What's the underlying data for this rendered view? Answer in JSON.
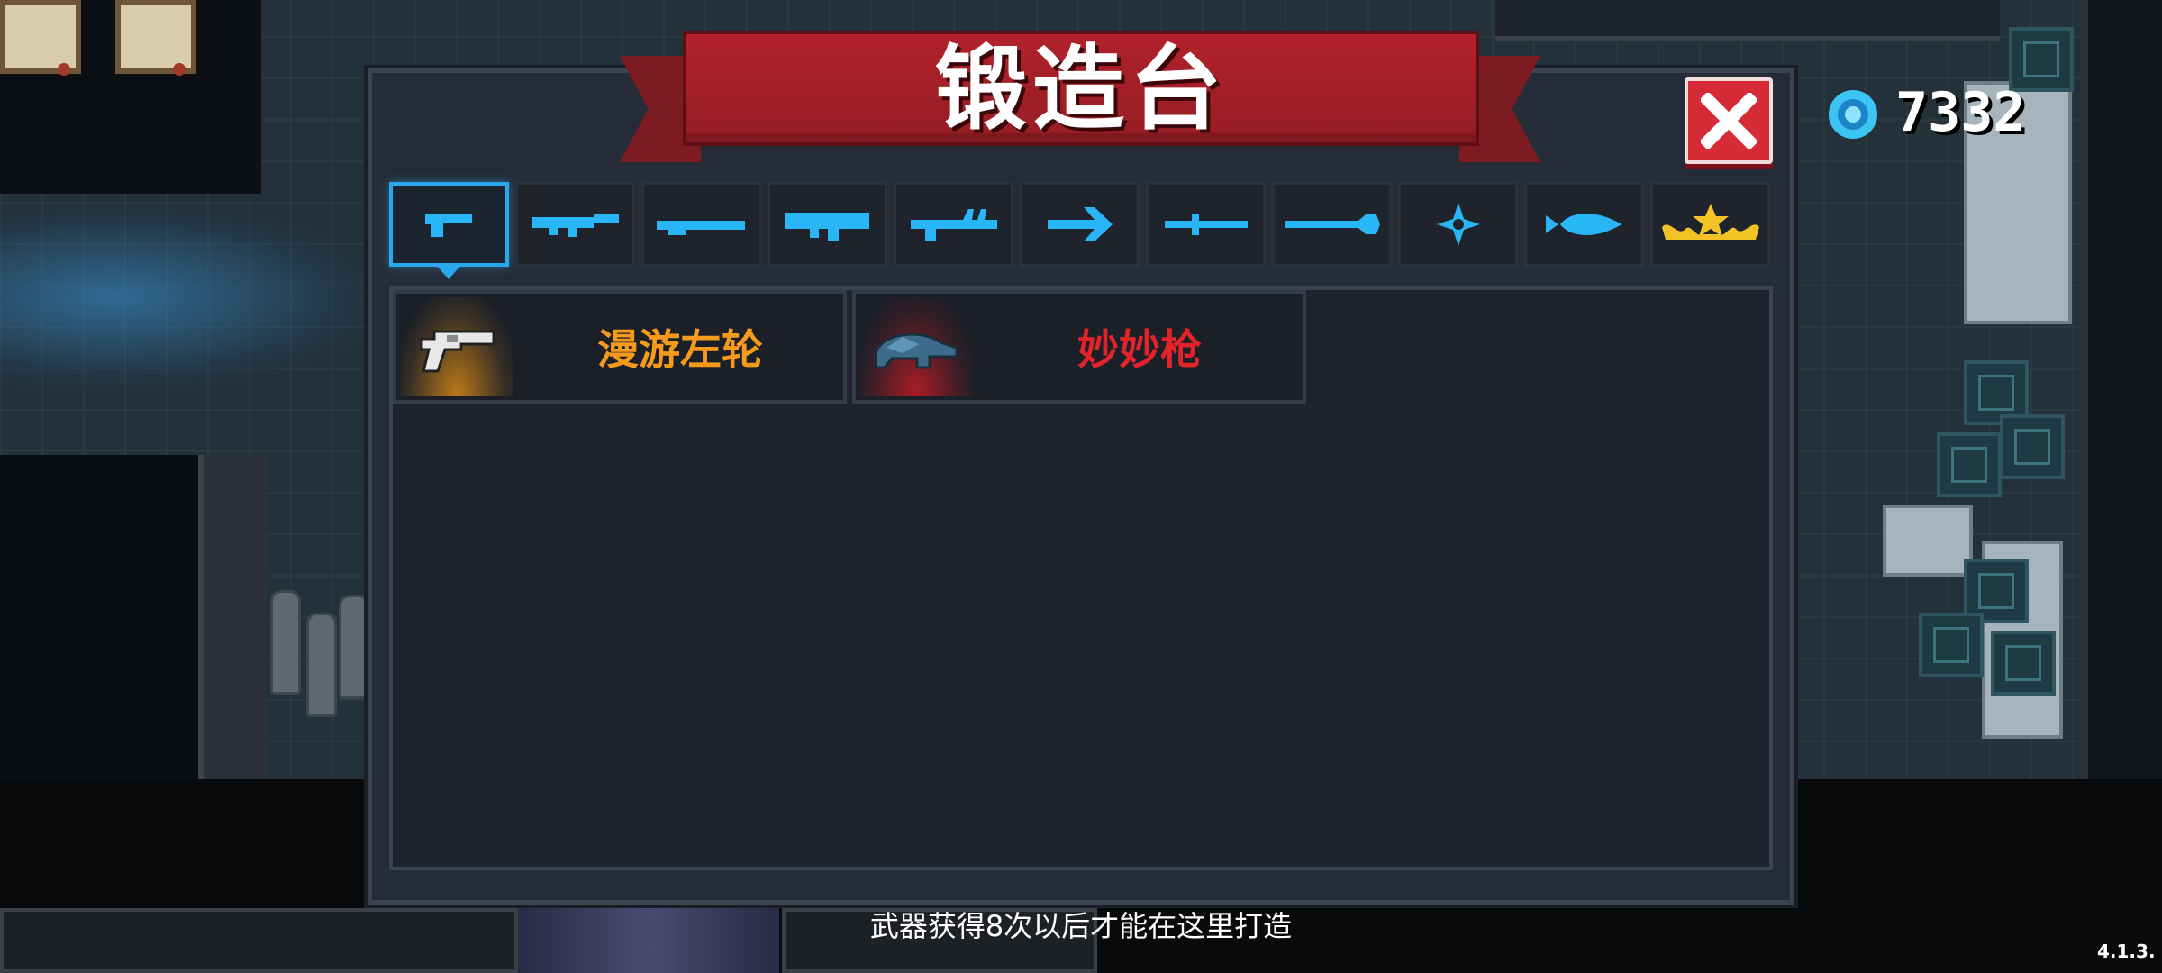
{
  "forge": {
    "title": "锻造台",
    "close_label": "✕",
    "hint": "武器获得8次以后才能在这里打造"
  },
  "currency": {
    "icon": "gem-icon",
    "amount": "7332",
    "color": "#3cc4f5"
  },
  "accent_color": "#29a8f0",
  "category_tabs": [
    {
      "icon": "pistol-icon",
      "selected": true
    },
    {
      "icon": "assault-rifle-icon",
      "selected": false
    },
    {
      "icon": "shotgun-icon",
      "selected": false
    },
    {
      "icon": "rocket-launcher-icon",
      "selected": false
    },
    {
      "icon": "laser-rifle-icon",
      "selected": false
    },
    {
      "icon": "bow-icon",
      "selected": false
    },
    {
      "icon": "sword-icon",
      "selected": false
    },
    {
      "icon": "spear-icon",
      "selected": false
    },
    {
      "icon": "shuriken-icon",
      "selected": false
    },
    {
      "icon": "fish-icon",
      "selected": false
    },
    {
      "icon": "crown-special-icon",
      "selected": false
    }
  ],
  "weapons": [
    {
      "name": "漫游左轮",
      "icon": "revolver-icon",
      "name_color": "#f59a1c",
      "glow_color": "#d98a16"
    },
    {
      "name": "妙妙枪",
      "icon": "turtle-gun-icon",
      "name_color": "#e2232a",
      "glow_color": "#c41c24"
    }
  ],
  "version": "4.1.3."
}
